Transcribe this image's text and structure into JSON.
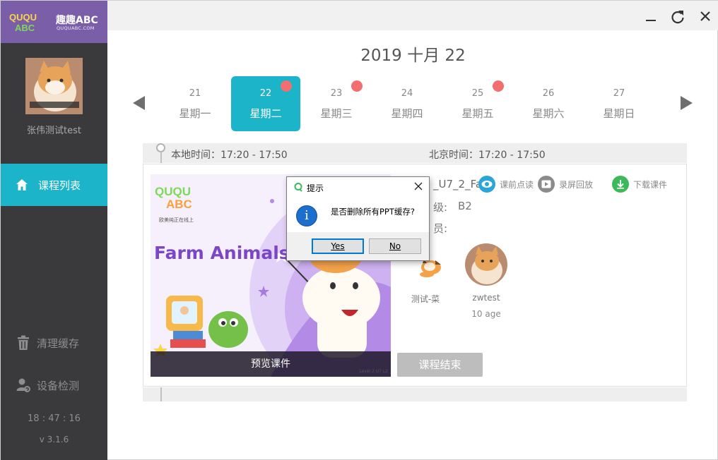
{
  "app": {
    "brand_cn": "趣趣ABC",
    "brand_url": "QUQUABC.COM",
    "logo_text": "QUQU ABC"
  },
  "user": {
    "name": "张伟测试test"
  },
  "sidebar": {
    "nav_active_label": "课程列表",
    "clear_cache_label": "清理缓存",
    "device_check_label": "设备检测",
    "clock": "18 : 47 : 16",
    "version": "v 3.1.6"
  },
  "date_header": {
    "title": "2019 十月 22",
    "days": [
      {
        "num": "21",
        "weekday": "星期一",
        "active": false,
        "dot": false
      },
      {
        "num": "22",
        "weekday": "星期二",
        "active": true,
        "dot": true
      },
      {
        "num": "23",
        "weekday": "星期三",
        "active": false,
        "dot": true
      },
      {
        "num": "24",
        "weekday": "星期四",
        "active": false,
        "dot": false
      },
      {
        "num": "25",
        "weekday": "星期五",
        "active": false,
        "dot": true
      },
      {
        "num": "26",
        "weekday": "星期六",
        "active": false,
        "dot": false
      },
      {
        "num": "27",
        "weekday": "星期日",
        "active": false,
        "dot": false
      }
    ]
  },
  "time": {
    "local": "本地时间：17:20 - 17:50",
    "beijing": "北京时间：17:20 - 17:50"
  },
  "lesson": {
    "cover_title": "Farm Animals",
    "cover_subtitle": "欧美纯正在线上",
    "cover_level": "Level 2 U7 L2",
    "preview_label": "预览课件",
    "course_name_partial": "_U7_2_Fa",
    "grade_label": "级:",
    "grade_value": "B2",
    "members_label": "员:",
    "actions": {
      "preread": "课前点读",
      "replay": "录屏回放",
      "download": "下载课件"
    },
    "members": [
      {
        "name": "测试-菜",
        "age": ""
      },
      {
        "name": "zwtest",
        "age": "10 age"
      }
    ],
    "end_button": "课程结束"
  },
  "dialog": {
    "title": "提示",
    "message": "是否删除所有PPT缓存?",
    "yes": "Yes",
    "no": "No"
  },
  "colors": {
    "accent": "#1cb4c9",
    "brand_purple": "#7b5ea8",
    "sidebar_bg": "#3a3a3c",
    "event_dot": "#f36f6f"
  }
}
